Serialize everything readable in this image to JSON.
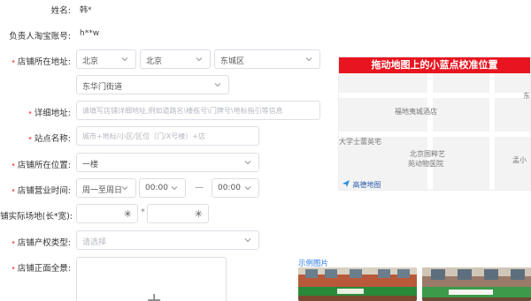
{
  "form": {
    "shop_name_label": "姓名:",
    "shop_name_value": "韩*",
    "taobao_account_label": "负责人淘宝账号:",
    "taobao_account_value": "h**w",
    "address": {
      "label": "店铺所在地址:",
      "province": "北京",
      "city": "北京",
      "district": "东城区",
      "street": "东华门街道"
    },
    "detail_address": {
      "label": "详细地址:",
      "placeholder": "请填写店铺详细地址,例如道路名\\楼栋号\\门牌号\\地标指引等信息"
    },
    "station_name": {
      "label": "站点名称:",
      "placeholder": "城市+地标/小区/区位（门/X号楼）+店"
    },
    "shop_position": {
      "label": "店铺所在位置:",
      "value": "一楼"
    },
    "business_hours": {
      "label": "店铺营业时间:",
      "days": "周一至周日",
      "open": "00:00",
      "separator": "—",
      "close": "00:00"
    },
    "actual_area": {
      "label": "铺实际场地(长*宽):",
      "multiply": "*"
    },
    "property_type": {
      "label": "店铺产权类型:",
      "placeholder": "请选择"
    },
    "front_photo": {
      "label": "店铺正面全景:",
      "plus": "+"
    },
    "required_mark": "•"
  },
  "map": {
    "banner": "拖动地图上的小蓝点校准位置",
    "places": [
      "福地夷城酒店",
      "大学士蕾英宅",
      "北京国粹艺",
      "苑动物医院",
      "孟小",
      "东"
    ],
    "logo_text": "高德地图"
  },
  "examples": {
    "label": "示例图片"
  },
  "colors": {
    "required": "#f56c6c",
    "banner": "#e8141f",
    "link": "#2d7be5",
    "border": "#dcdfe6"
  }
}
